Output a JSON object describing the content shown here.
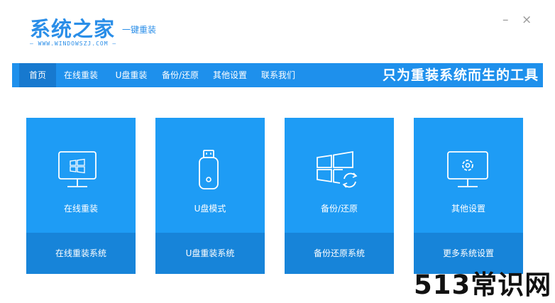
{
  "app": {
    "logo_main": "系统之家",
    "logo_tag": "一键重装",
    "logo_url": "— WWW.WINDOWSZJ.COM —",
    "minimize_glyph": "–",
    "close_glyph": "×"
  },
  "nav": {
    "items": [
      {
        "label": "首页",
        "active": true
      },
      {
        "label": "在线重装"
      },
      {
        "label": "U盘重装"
      },
      {
        "label": "备份/还原"
      },
      {
        "label": "其他设置"
      },
      {
        "label": "联系我们"
      }
    ],
    "slogan": "只为重装系统而生的工具"
  },
  "cards": [
    {
      "label": "在线重装",
      "action": "在线重装系统",
      "icon": "monitor-windows-icon"
    },
    {
      "label": "U盘模式",
      "action": "U盘重装系统",
      "icon": "usb-drive-icon"
    },
    {
      "label": "备份/还原",
      "action": "备份还原系统",
      "icon": "windows-restore-icon"
    },
    {
      "label": "其他设置",
      "action": "更多系统设置",
      "icon": "monitor-gear-icon"
    }
  ],
  "watermark": "513常识网",
  "colors": {
    "brand": "#2a8ee8",
    "nav_bg": "#1e90ec",
    "nav_active": "#1779cf",
    "card_top": "#1e9cf5",
    "card_bottom": "#1784d9"
  }
}
